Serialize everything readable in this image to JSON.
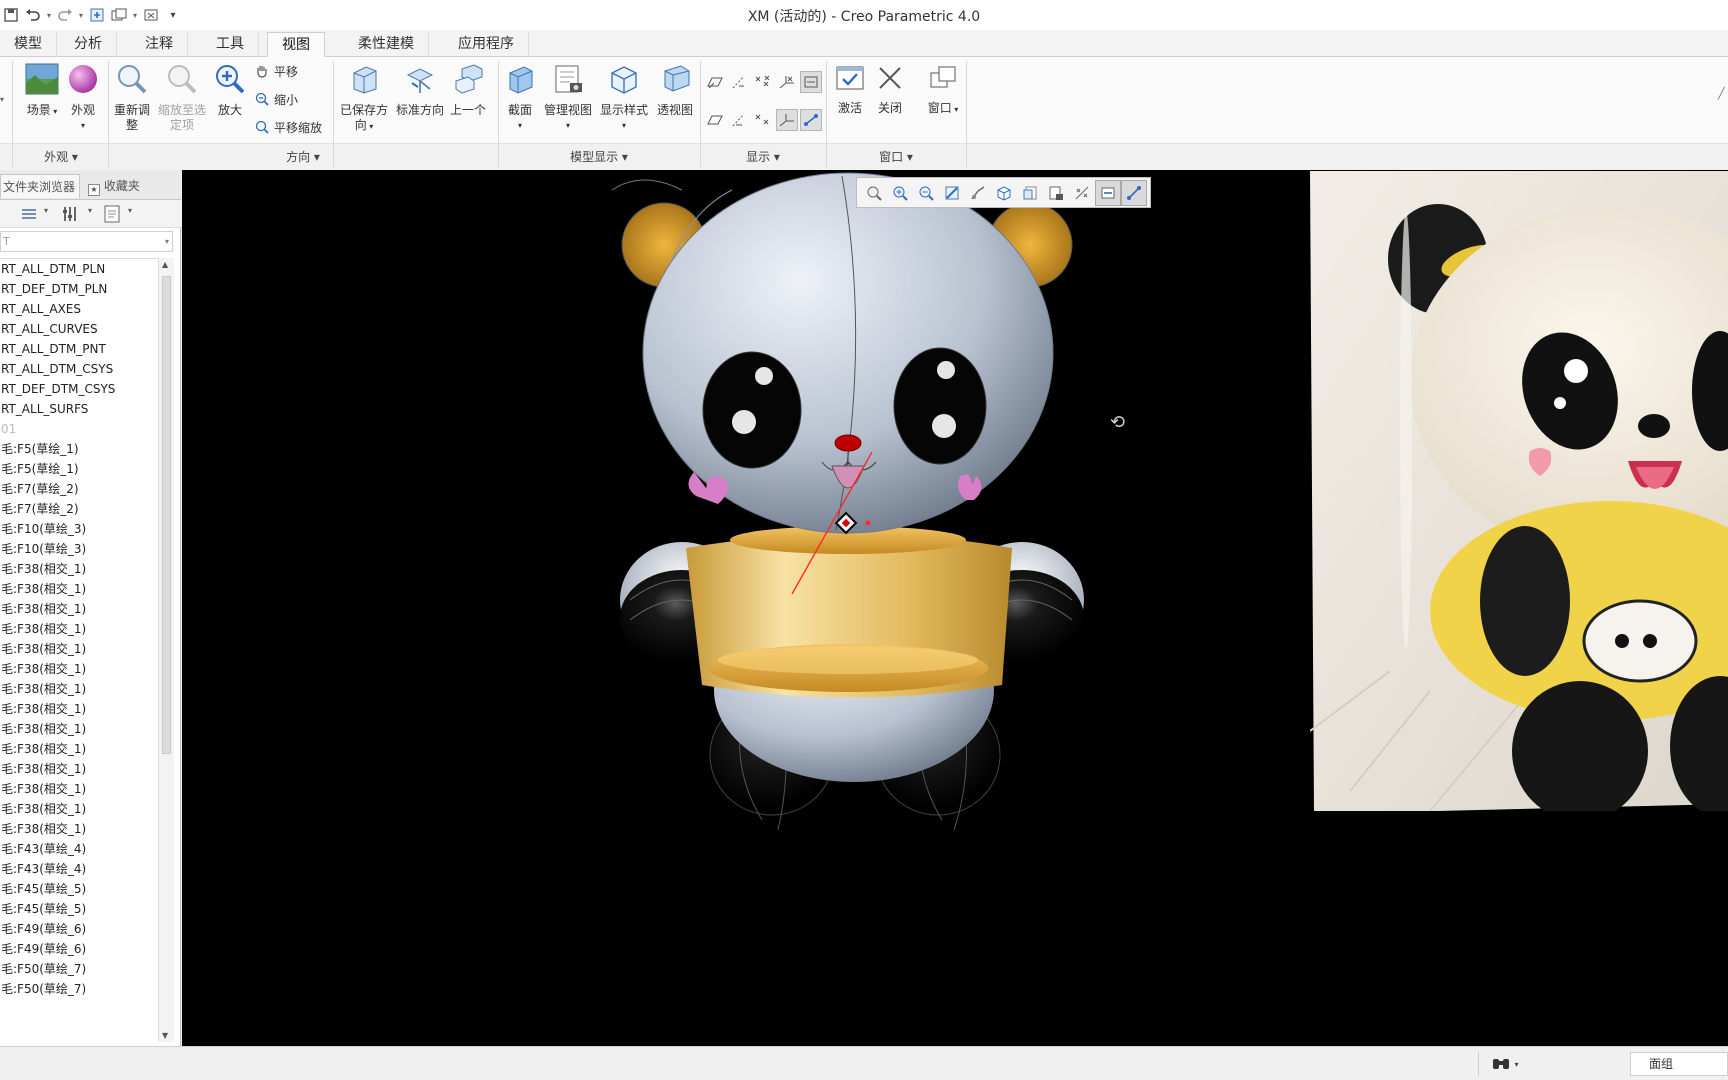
{
  "window": {
    "title": "XM (活动的) - Creo Parametric 4.0"
  },
  "quick_access": [
    {
      "icon": "save-icon"
    },
    {
      "icon": "undo-icon"
    },
    {
      "icon": "redo-icon"
    },
    {
      "icon": "regenerate-icon"
    },
    {
      "icon": "windows-icon"
    },
    {
      "icon": "close-window-icon"
    },
    {
      "icon": "customize-icon"
    }
  ],
  "tabs": [
    {
      "label": "模型"
    },
    {
      "label": "分析"
    },
    {
      "label": "注释"
    },
    {
      "label": "工具"
    },
    {
      "label": "视图",
      "active": true
    },
    {
      "label": "柔性建模"
    },
    {
      "label": "应用程序"
    }
  ],
  "ribbon": {
    "appearance": {
      "label": "外观",
      "scene": "场景",
      "appearance": "外观"
    },
    "orientation": {
      "label": "方向",
      "refit_1": "重新调",
      "refit_2": "整",
      "zoom_target_1": "缩放至选",
      "zoom_target_2": "定项",
      "zoom_in": "放大",
      "pan": "平移",
      "zoom_out": "缩小",
      "pan_zoom": "平移缩放",
      "saved_views_1": "已保存方",
      "saved_views_2": "向",
      "standard_orientation": "标准方向",
      "previous": "上一个"
    },
    "model_display": {
      "label": "模型显示",
      "section": "截面",
      "manage_views": "管理视图",
      "display_style": "显示样式",
      "perspective": "透视图"
    },
    "show": {
      "label": "显示"
    },
    "window": {
      "label": "窗口",
      "activate": "激活",
      "close": "关闭",
      "windows": "窗口"
    }
  },
  "navigator": {
    "tabs": [
      {
        "label": "文件夹浏览器"
      },
      {
        "label": "收藏夹"
      }
    ],
    "filter_placeholder": "T",
    "tree": [
      "RT_ALL_DTM_PLN",
      "RT_DEF_DTM_PLN",
      "RT_ALL_AXES",
      "RT_ALL_CURVES",
      "RT_ALL_DTM_PNT",
      "RT_ALL_DTM_CSYS",
      "RT_DEF_DTM_CSYS",
      "RT_ALL_SURFS",
      "01",
      "毛:F5(草绘_1)",
      "毛:F5(草绘_1)",
      "毛:F7(草绘_2)",
      "毛:F7(草绘_2)",
      "毛:F10(草绘_3)",
      "毛:F10(草绘_3)",
      "毛:F38(相交_1)",
      "毛:F38(相交_1)",
      "毛:F38(相交_1)",
      "毛:F38(相交_1)",
      "毛:F38(相交_1)",
      "毛:F38(相交_1)",
      "毛:F38(相交_1)",
      "毛:F38(相交_1)",
      "毛:F38(相交_1)",
      "毛:F38(相交_1)",
      "毛:F38(相交_1)",
      "毛:F38(相交_1)",
      "毛:F38(相交_1)",
      "毛:F38(相交_1)",
      "毛:F43(草绘_4)",
      "毛:F43(草绘_4)",
      "毛:F45(草绘_5)",
      "毛:F45(草绘_5)",
      "毛:F49(草绘_6)",
      "毛:F49(草绘_6)",
      "毛:F50(草绘_7)",
      "毛:F50(草绘_7)"
    ]
  },
  "status_bar": {
    "filter": "面组"
  },
  "colors": {
    "accent": "#1f6fd1",
    "graphics_bg": "#000000",
    "panda_body": "#b8c2d0",
    "panda_shirt": "#e5b95a",
    "panda_ears": "#d4a43a"
  }
}
